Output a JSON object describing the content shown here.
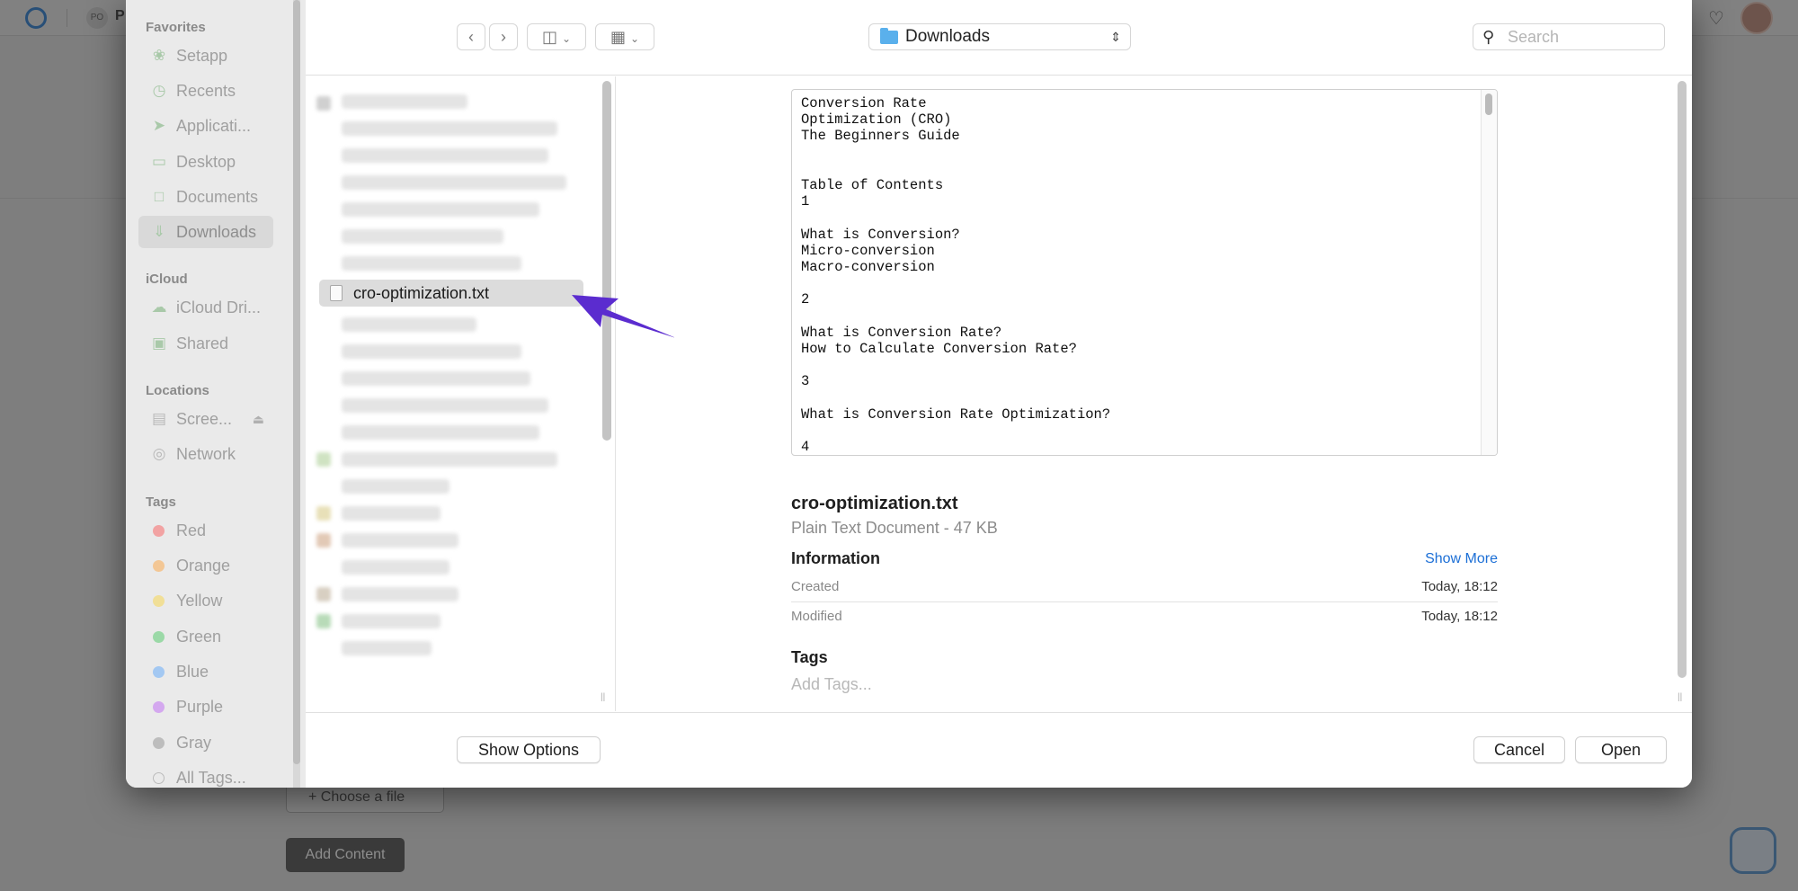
{
  "background": {
    "workspace_badge": "PO",
    "workspace_letter": "P",
    "choose_file_label": "Choose a file",
    "add_content_label": "Add Content"
  },
  "sidebar": {
    "favorites_heading": "Favorites",
    "favorites": [
      {
        "label": "Setapp",
        "icon": "setapp-icon"
      },
      {
        "label": "Recents",
        "icon": "clock-icon"
      },
      {
        "label": "Applicati...",
        "icon": "applications-icon"
      },
      {
        "label": "Desktop",
        "icon": "desktop-icon"
      },
      {
        "label": "Documents",
        "icon": "document-icon"
      },
      {
        "label": "Downloads",
        "icon": "download-icon",
        "selected": true
      }
    ],
    "icloud_heading": "iCloud",
    "icloud": [
      {
        "label": "iCloud Dri...",
        "icon": "cloud-icon"
      },
      {
        "label": "Shared",
        "icon": "shared-folder-icon"
      }
    ],
    "locations_heading": "Locations",
    "locations": [
      {
        "label": "Scree...",
        "icon": "drive-icon"
      },
      {
        "label": "Network",
        "icon": "globe-icon"
      }
    ],
    "tags_heading": "Tags",
    "tags": [
      {
        "label": "Red",
        "color": "#f2a3a3"
      },
      {
        "label": "Orange",
        "color": "#f3c795"
      },
      {
        "label": "Yellow",
        "color": "#f1df97"
      },
      {
        "label": "Green",
        "color": "#9bd9a7"
      },
      {
        "label": "Blue",
        "color": "#a3c8f2"
      },
      {
        "label": "Purple",
        "color": "#d4a8ef"
      },
      {
        "label": "Gray",
        "color": "#bdbdbd"
      },
      {
        "label": "All Tags...",
        "color": "none"
      }
    ]
  },
  "toolbar": {
    "location": "Downloads",
    "search_placeholder": "Search"
  },
  "file_list": {
    "selected_file": "cro-optimization.txt"
  },
  "preview": {
    "text_lines": "Conversion Rate\nOptimization (CRO)\nThe Beginners Guide\n\n\nTable of Contents\n1\n\nWhat is Conversion?\nMicro-conversion\nMacro-conversion\n\n2\n\nWhat is Conversion Rate?\nHow to Calculate Conversion Rate?\n\n3\n\nWhat is Conversion Rate Optimization?\n\n4",
    "file_name": "cro-optimization.txt",
    "file_kind": "Plain Text Document - 47 KB",
    "information_heading": "Information",
    "show_more_label": "Show More",
    "created_label": "Created",
    "created_value": "Today, 18:12",
    "modified_label": "Modified",
    "modified_value": "Today, 18:12",
    "tags_heading": "Tags",
    "tags_placeholder": "Add Tags..."
  },
  "bottom": {
    "show_options_label": "Show Options",
    "cancel_label": "Cancel",
    "open_label": "Open"
  },
  "colors": {
    "accent_link": "#1c6fd6",
    "arrow": "#5b2ccf"
  }
}
